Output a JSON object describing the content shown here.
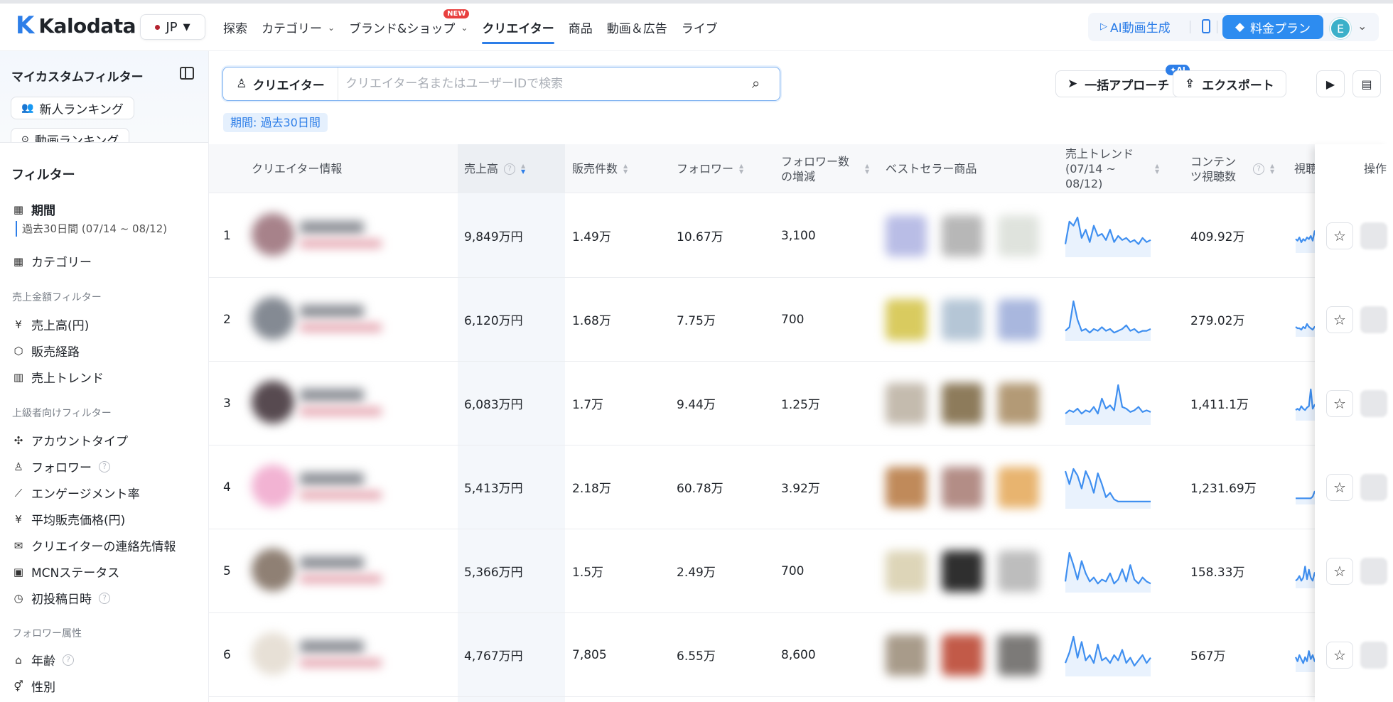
{
  "nav": {
    "brand": "Kalodata",
    "country": "JP",
    "items": [
      {
        "label": "探索",
        "dropdown": false,
        "new": false,
        "active": false
      },
      {
        "label": "カテゴリー",
        "dropdown": true,
        "new": false,
        "active": false
      },
      {
        "label": "ブランド&ショップ",
        "dropdown": true,
        "new": true,
        "active": false
      },
      {
        "label": "クリエイター",
        "dropdown": false,
        "new": false,
        "active": true
      },
      {
        "label": "商品",
        "dropdown": false,
        "new": false,
        "active": false
      },
      {
        "label": "動画＆広告",
        "dropdown": false,
        "new": false,
        "active": false
      },
      {
        "label": "ライブ",
        "dropdown": false,
        "new": false,
        "active": false
      }
    ],
    "new_badge": "NEW",
    "ai_video": "AI動画生成",
    "pricing": "料金プラン",
    "avatar_letter": "E"
  },
  "sidebar": {
    "custom_filter_title": "マイカスタムフィルター",
    "chips": [
      "新人ランキング",
      "動画ランキング"
    ],
    "filter_title": "フィルター",
    "period_label": "期間",
    "period_value": "過去30日間 (07/14 ~ 08/12)",
    "category": "カテゴリー",
    "sales_section": "売上金額フィルター",
    "sales_items": [
      "売上高(円)",
      "販売経路",
      "売上トレンド"
    ],
    "advanced_section": "上級者向けフィルター",
    "advanced_items": [
      "アカウントタイプ",
      "フォロワー",
      "エンゲージメント率",
      "平均販売価格(円)",
      "クリエイターの連絡先情報",
      "MCNステータス",
      "初投稿日時"
    ],
    "follower_section": "フォロワー属性",
    "follower_items": [
      "年齢",
      "性別"
    ]
  },
  "toolbar": {
    "search_type": "クリエイター",
    "search_placeholder": "クリエイター名またはユーザーIDで検索",
    "period_tag": "期間: 過去30日間",
    "bulk_approach": "一括アプローチ",
    "ai_tag": "AI",
    "export": "エクスポート"
  },
  "table": {
    "headers": {
      "creator": "クリエイター情報",
      "revenue": "売上高",
      "items_sold": "販売件数",
      "followers": "フォロワー",
      "follower_growth": "フォロワー数\nの増減",
      "bestseller": "ベストセラー商品",
      "trend": "売上トレンド\n(07/14 ~ 08/12)",
      "views": "コンテン\nツ視聴数",
      "views2": "視聴",
      "actions": "操作"
    },
    "rows": [
      {
        "rank": "1",
        "revenue": "9,849万円",
        "items_sold": "1.49万",
        "followers": "10.67万",
        "growth": "3,100",
        "views": "409.92万",
        "trend": [
          5,
          16,
          14,
          18,
          8,
          12,
          6,
          14,
          9,
          10,
          7,
          12,
          6,
          9,
          7,
          8,
          6,
          7,
          5,
          8,
          6,
          7
        ],
        "avatar": "#a7828a",
        "prods": [
          "#b9bde6",
          "#b7b7b7",
          "#dfe3dd"
        ]
      },
      {
        "rank": "2",
        "revenue": "6,120万円",
        "items_sold": "1.68万",
        "followers": "7.75万",
        "growth": "700",
        "views": "279.02万",
        "trend": [
          4,
          6,
          20,
          10,
          4,
          5,
          3,
          5,
          4,
          6,
          4,
          5,
          3,
          4,
          5,
          7,
          4,
          5,
          3,
          4,
          4,
          5
        ],
        "avatar": "#848a93",
        "prods": [
          "#d9cb5f",
          "#b5c6d6",
          "#a9b7de"
        ]
      },
      {
        "rank": "3",
        "revenue": "6,083万円",
        "items_sold": "1.7万",
        "followers": "9.44万",
        "growth": "1.25万",
        "views": "1,411.1万",
        "trend": [
          5,
          7,
          6,
          8,
          5,
          7,
          6,
          9,
          5,
          14,
          8,
          10,
          7,
          22,
          9,
          8,
          6,
          7,
          9,
          6,
          7,
          6
        ],
        "avatar": "#574a50",
        "prods": [
          "#c4bbae",
          "#8d7b5b",
          "#b39a76"
        ]
      },
      {
        "rank": "4",
        "revenue": "5,413万円",
        "items_sold": "2.18万",
        "followers": "60.78万",
        "growth": "3.92万",
        "views": "1,231.69万",
        "trend": [
          16,
          10,
          17,
          14,
          8,
          16,
          12,
          6,
          15,
          10,
          4,
          6,
          3,
          2,
          2,
          2,
          2,
          2,
          2,
          2,
          2,
          2
        ],
        "avatar": "#f2b3d3",
        "prods": [
          "#c08a5a",
          "#b38d86",
          "#e8b46f"
        ]
      },
      {
        "rank": "5",
        "revenue": "5,366万円",
        "items_sold": "1.5万",
        "followers": "2.49万",
        "growth": "700",
        "views": "158.33万",
        "trend": [
          4,
          18,
          12,
          5,
          14,
          8,
          4,
          6,
          3,
          5,
          4,
          8,
          3,
          5,
          10,
          4,
          12,
          5,
          3,
          6,
          4,
          3
        ],
        "avatar": "#8f8074",
        "prods": [
          "#ddd5b8",
          "#2f2f2f",
          "#bdbdbd"
        ]
      },
      {
        "rank": "6",
        "revenue": "4,767万円",
        "items_sold": "7,805",
        "followers": "6.55万",
        "growth": "8,600",
        "views": "567万",
        "trend": [
          4,
          8,
          14,
          6,
          12,
          5,
          7,
          4,
          11,
          5,
          6,
          4,
          7,
          5,
          9,
          4,
          6,
          3,
          5,
          7,
          4,
          6
        ],
        "avatar": "#e7e0d6",
        "prods": [
          "#a89b8a",
          "#c25a48",
          "#7c7a78"
        ]
      }
    ]
  },
  "colors": {
    "accent": "#2d7ee8",
    "new_badge": "#e8403f",
    "line": "#3f8ff0"
  }
}
